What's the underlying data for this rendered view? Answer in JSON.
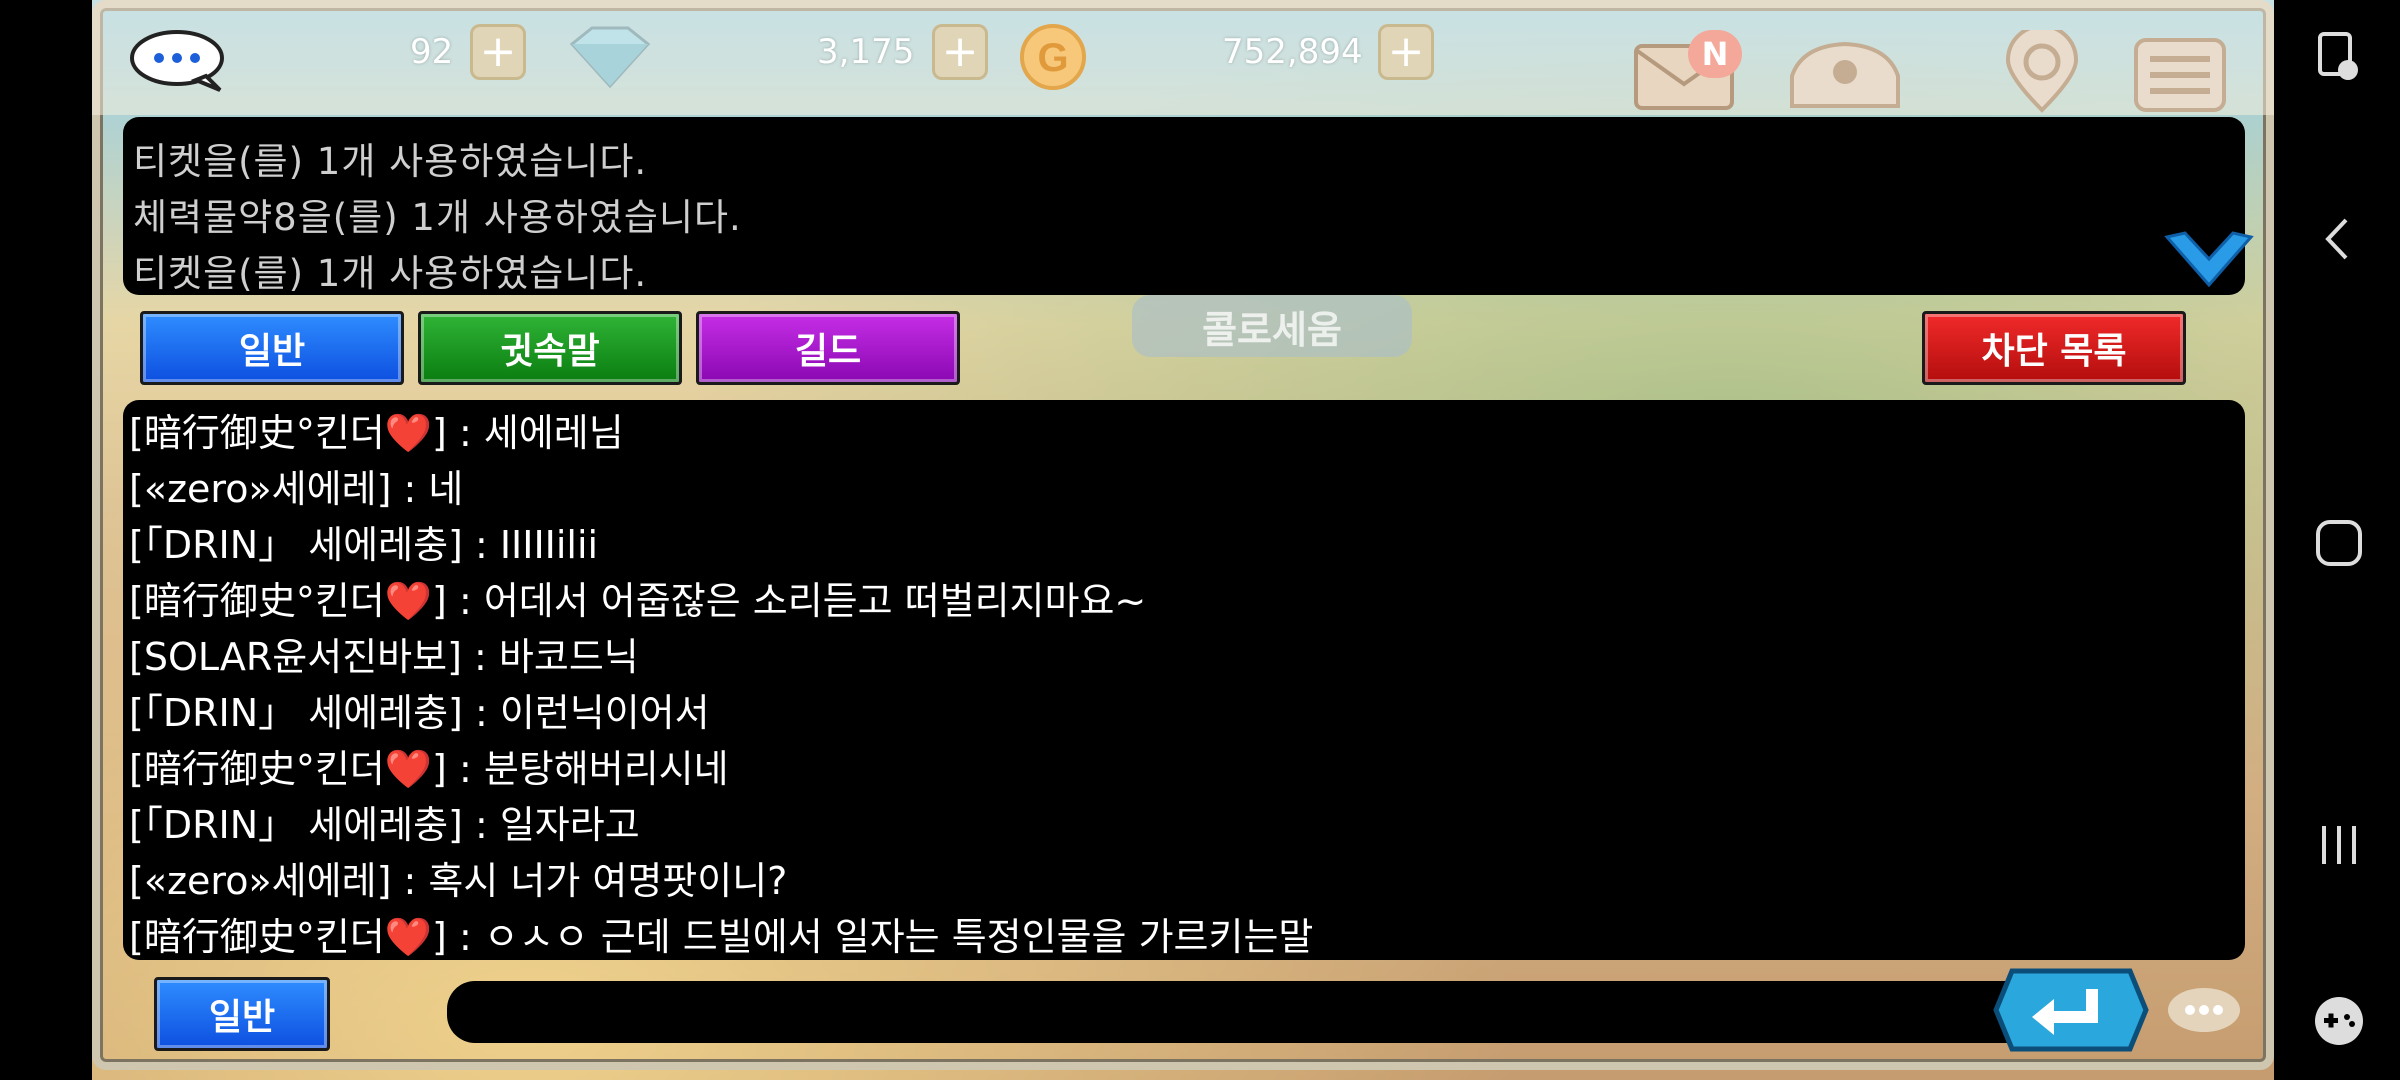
{
  "topbar": {
    "hearts": "92",
    "gems": "3,175",
    "gold": "752,894",
    "mail_badge": "N",
    "icons": [
      "chat-icon",
      "heart-icon",
      "gem-icon",
      "gold-coin-icon",
      "mail-icon",
      "shop-icon",
      "map-icon",
      "menu-icon"
    ]
  },
  "system_messages": [
    "티켓을(를) 1개 사용하였습니다.",
    "체력물약8을(를) 1개 사용하였습니다.",
    "티켓을(를) 1개 사용하였습니다."
  ],
  "tabs": {
    "general": "일반",
    "whisper": "귓속말",
    "guild": "길드",
    "block_list": "차단 목록"
  },
  "background_label": "콜로세움",
  "chat": [
    {
      "sender": "[暗行御史°킨더❤️]",
      "text": " : 세에레님"
    },
    {
      "sender": "[«zero»세에레]",
      "text": " : 네"
    },
    {
      "sender": "[「DRIN」 세에레충]",
      "text": " : IIIIIilii"
    },
    {
      "sender": "[暗行御史°킨더❤️]",
      "text": " : 어데서 어줍잖은 소리듣고 떠벌리지마요~"
    },
    {
      "sender": "[SOLAR윤서진바보]",
      "text": " : 바코드닉"
    },
    {
      "sender": "[「DRIN」 세에레충]",
      "text": " : 이런닉이어서"
    },
    {
      "sender": "[暗行御史°킨더❤️]",
      "text": " : 분탕해버리시네"
    },
    {
      "sender": "[「DRIN」 세에레충]",
      "text": " : 일자라고"
    },
    {
      "sender": "[«zero»세에레]",
      "text": " : 혹시 너가 여명팟이니?"
    },
    {
      "sender": "[暗行御史°킨더❤️]",
      "text": " : ㅇㅅㅇ 근데 드빌에서 일자는 특정인물을 가르키는말"
    }
  ],
  "input": {
    "mode_label": "일반",
    "value": "",
    "placeholder": ""
  },
  "colors": {
    "tab_blue": "#1565f0",
    "tab_green": "#128f19",
    "tab_purple": "#a912d0",
    "tab_red": "#d11a1a",
    "enter_button": "#2aa7dc"
  }
}
